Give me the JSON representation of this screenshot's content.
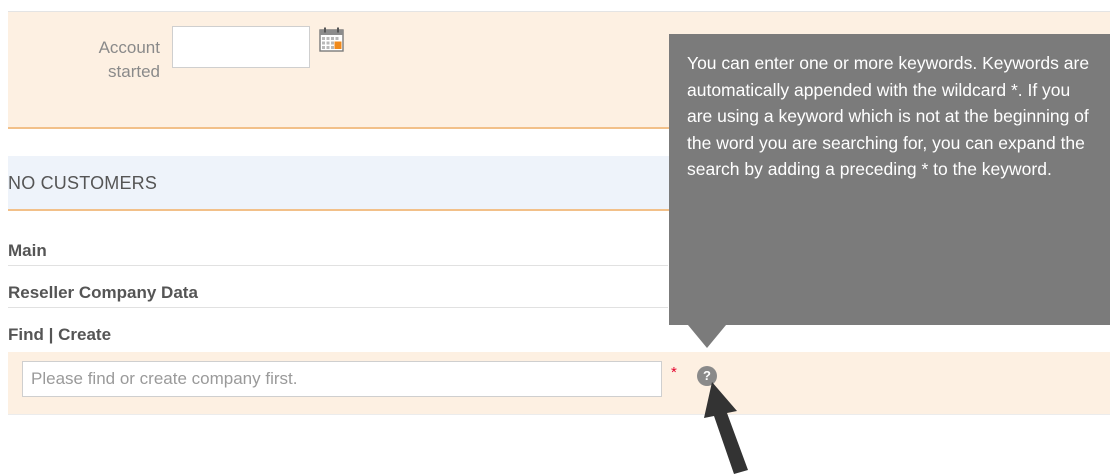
{
  "filter": {
    "account_started_label": "Account\nstarted",
    "account_started_value": ""
  },
  "section": {
    "title": "NO CUSTOMERS"
  },
  "nav": {
    "main": "Main",
    "reseller_company_data": "Reseller Company Data",
    "find": "Find",
    "separator": "|",
    "create": "Create"
  },
  "company_field": {
    "placeholder": "Please find or create company first.",
    "required_marker": "*",
    "help_icon_glyph": "?"
  },
  "tooltip": {
    "text": "You can enter one or more keywords. Keywords are automatically appended with the wildcard *. If you are using a keyword which is not at the beginning of the word you are searching for, you can expand the search by adding a preceding * to the keyword."
  },
  "icons": [
    "calendar-icon",
    "help-icon",
    "pointer-arrow-icon"
  ],
  "colors": {
    "panel_background": "#fdf0e2",
    "accent_border": "#f2c089",
    "section_header_background": "#eef3fa",
    "tooltip_background": "#7b7b7b",
    "required": "#e4002b"
  }
}
